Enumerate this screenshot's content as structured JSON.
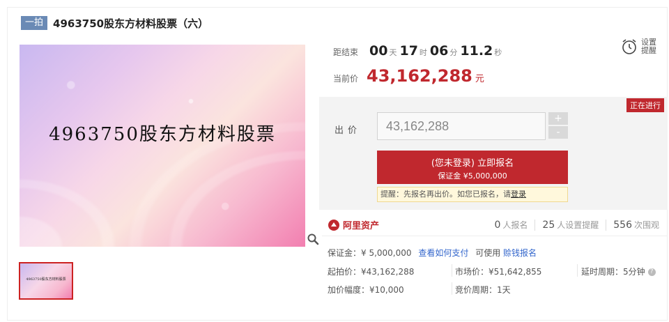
{
  "header": {
    "auction_tag": "一拍",
    "title": "4963750股东方材料股票（六）"
  },
  "image": {
    "main_text": "4963750股东方材料股票",
    "thumb_text": "4963750股东方材料股票"
  },
  "countdown": {
    "label": "距结束",
    "days": "00",
    "days_unit": "天",
    "hours": "17",
    "hours_unit": "时",
    "minutes": "06",
    "minutes_unit": "分",
    "seconds": "11.2",
    "seconds_unit": "秒"
  },
  "current_price": {
    "label": "当前价",
    "value": "43,162,288",
    "unit": "元"
  },
  "reminder": {
    "label": "设置提醒"
  },
  "status_badge": "正在进行",
  "bid": {
    "label": "出价",
    "value": "43,162,288",
    "plus": "+",
    "minus": "-",
    "signup_main": "(您未登录) 立即报名",
    "signup_sub": "保证金 ¥5,000,000",
    "tip_text": "提醒：先报名再出价。如您已报名，请",
    "tip_link": "登录"
  },
  "brand": {
    "name": "阿里资产"
  },
  "stats": [
    {
      "value": "0",
      "label": "人报名"
    },
    {
      "value": "25",
      "label": "人设置提醒"
    },
    {
      "value": "556",
      "label": "次围观"
    }
  ],
  "deposit": {
    "text": "保证金：¥ 5,000,000",
    "how_to_pay": "查看如何支付",
    "available_text": "可使用",
    "credit_link": "赊钱报名"
  },
  "info": {
    "start_price": "起拍价：¥43,162,288",
    "market_price": "市场价：¥51,642,855",
    "delay_period": "延时周期：5分钟",
    "increment": "加价幅度：¥10,000",
    "auction_period": "竞价周期：1天"
  }
}
